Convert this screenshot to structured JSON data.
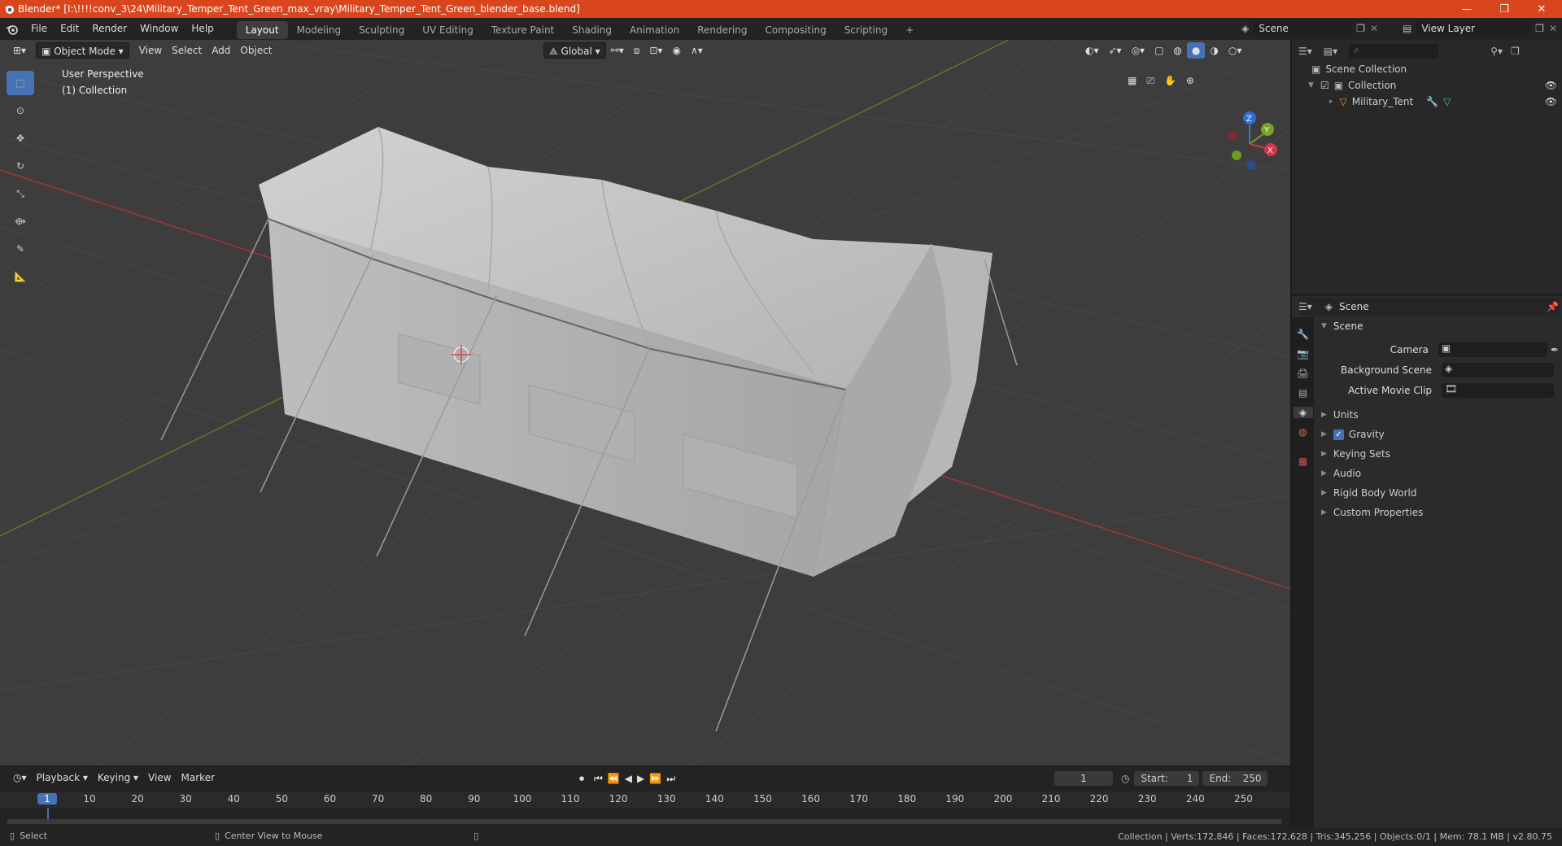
{
  "window": {
    "title": "Blender* [I:\\!!!!conv_3\\24\\Military_Temper_Tent_Green_max_vray\\Military_Temper_Tent_Green_blender_base.blend]",
    "minimize": "—",
    "maximize": "❐",
    "close": "✕"
  },
  "menu": [
    "File",
    "Edit",
    "Render",
    "Window",
    "Help"
  ],
  "workspaces": [
    "Layout",
    "Modeling",
    "Sculpting",
    "UV Editing",
    "Texture Paint",
    "Shading",
    "Animation",
    "Rendering",
    "Compositing",
    "Scripting"
  ],
  "workspace_add": "+",
  "scene_selector": "Scene",
  "view_layer": "View Layer",
  "viewport_header": {
    "mode": "Object Mode",
    "view": "View",
    "select": "Select",
    "add": "Add",
    "object": "Object",
    "orientation": "Global"
  },
  "viewport": {
    "perspective_label": "User Perspective",
    "collection_label": "(1) Collection",
    "gizmo_x": "X",
    "gizmo_y": "Y",
    "gizmo_z": "Z"
  },
  "outliner": {
    "root": "Scene Collection",
    "collection": "Collection",
    "object": "Military_Tent"
  },
  "properties": {
    "tab_title": "Scene",
    "section": "Scene",
    "camera_label": "Camera",
    "background_scene_label": "Background Scene",
    "active_movie_clip_label": "Active Movie Clip",
    "panels": [
      "Units",
      "Gravity",
      "Keying Sets",
      "Audio",
      "Rigid Body World",
      "Custom Properties"
    ],
    "gravity_checked": true
  },
  "timeline": {
    "playback": "Playback",
    "keying": "Keying",
    "view": "View",
    "marker": "Marker",
    "current_frame": "1",
    "start_label": "Start:",
    "start": "1",
    "end_label": "End:",
    "end": "250",
    "ruler": [
      "1",
      "10",
      "20",
      "30",
      "40",
      "50",
      "60",
      "70",
      "80",
      "90",
      "100",
      "110",
      "120",
      "130",
      "140",
      "150",
      "160",
      "170",
      "180",
      "190",
      "200",
      "210",
      "220",
      "230",
      "240",
      "250"
    ]
  },
  "status": {
    "select": "Select",
    "center_view": "Center View to Mouse",
    "stats": "Collection | Verts:172,846 | Faces:172,628 | Tris:345,256 | Objects:0/1 | Mem: 78.1 MB | v2.80.75"
  },
  "colors": {
    "titlebar": "#d9451c",
    "accent": "#4772b3",
    "x_axis": "#c63b3b",
    "y_axis": "#7a9a2a"
  }
}
